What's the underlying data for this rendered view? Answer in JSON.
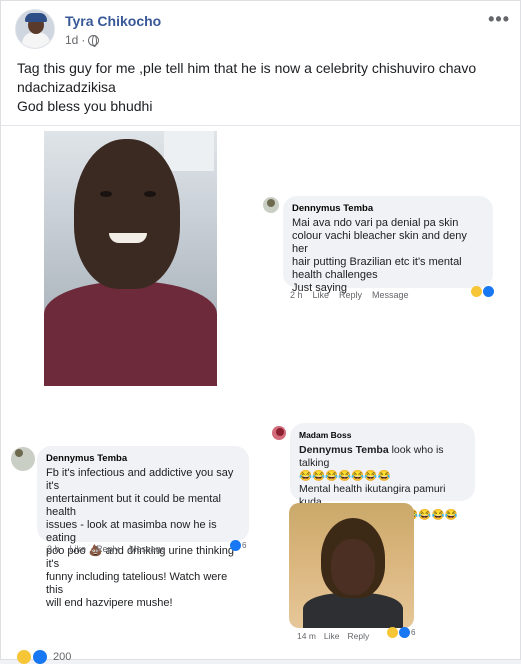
{
  "post": {
    "author": "Tyra Chikocho",
    "time": "1d",
    "more": "•••",
    "text_line1": "Tag this guy for me ,ple tell him that he is now a celebrity chishuviro chavo",
    "text_line2": "ndachizadzikisa",
    "text_line3": "God bless you bhudhi"
  },
  "comment1": {
    "author": "Dennymus Temba",
    "lines": [
      "Mai ava ndo vari pa denial pa skin",
      "colour vachi bleacher skin and deny her",
      "hair putting Brazilian etc it's mental",
      "health challenges",
      "Just saying"
    ],
    "time": "2 h",
    "like": "Like",
    "reply": "Reply",
    "message": "Message"
  },
  "comment2": {
    "author": "Dennymus Temba",
    "lines": [
      "Fb it's infectious and addictive you say it's",
      "entertainment but it could be mental health",
      "issues - look at masimba now he is eating",
      "poo poo 💩 and drinking urine thinking it's",
      "funny including tatelious! Watch were this",
      "will end hazvipere mushe!"
    ],
    "time": "2 h",
    "like": "Like",
    "reply": "Reply",
    "message": "Message",
    "reaction_count": "6"
  },
  "comment3": {
    "author": "Madam Boss",
    "mention": "Dennymus Temba",
    "line1_rest": " look who is talking",
    "emoji_row": "😂😂😂😂😂😂😂",
    "line3": "Mental health ikutangira pamuri kuda",
    "line4": "kuita mukadzi 😂😂😂😂😂😂😂",
    "time": "14 m",
    "like": "Like",
    "reply": "Reply",
    "reaction_count": "6"
  },
  "footer": {
    "count": "200"
  }
}
